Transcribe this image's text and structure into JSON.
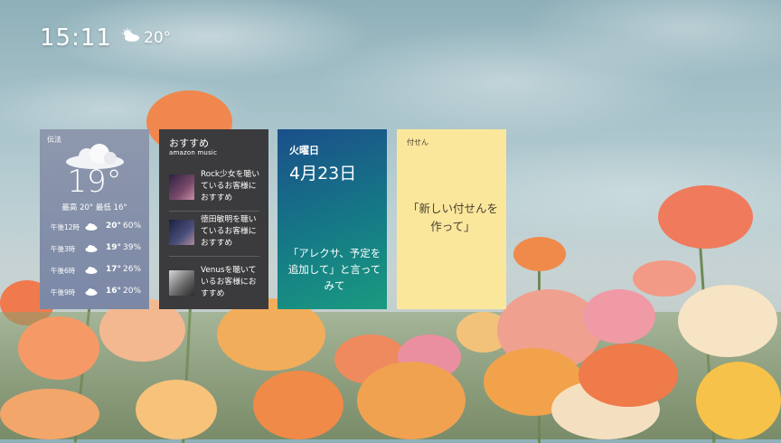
{
  "status": {
    "time": "15:11",
    "temperature": "20°",
    "weather_icon": "partly-cloudy-icon"
  },
  "weather_card": {
    "location": "伝法",
    "current_temp": "19°",
    "high_low": "最高 20°  最低 16°",
    "hourly": [
      {
        "time": "午後12時",
        "icon": "cloud-icon",
        "temp": "20°",
        "precip": "60%"
      },
      {
        "time": "午後3時",
        "icon": "cloud-icon",
        "temp": "19°",
        "precip": "39%"
      },
      {
        "time": "午後6時",
        "icon": "cloud-icon",
        "temp": "17°",
        "precip": "26%"
      },
      {
        "time": "午後9時",
        "icon": "cloud-icon",
        "temp": "16°",
        "precip": "20%"
      }
    ]
  },
  "music_card": {
    "title": "おすすめ",
    "brand": "amazon music",
    "items": [
      {
        "text": "Rock少女を聴いているお客様におすすめ",
        "accent": "#7a4a6a"
      },
      {
        "text": "徳田敏明を聴いているお客様におすすめ",
        "accent": "#4a4f7a"
      },
      {
        "text": "Venusを聴いているお客様におすすめ",
        "accent": "#6b6b6b"
      }
    ],
    "page_count": 3,
    "current_page": 1
  },
  "calendar_card": {
    "day": "火曜日",
    "date": "4月23日",
    "hint": "「アレクサ、予定を追加して」と言ってみて"
  },
  "sticky_card": {
    "title": "付せん",
    "body": "「新しい付せんを作って」"
  },
  "colors": {
    "sticky": "#fbe79c",
    "music_bg": "#3b3b3d",
    "weather_bg": "#8591aa"
  }
}
